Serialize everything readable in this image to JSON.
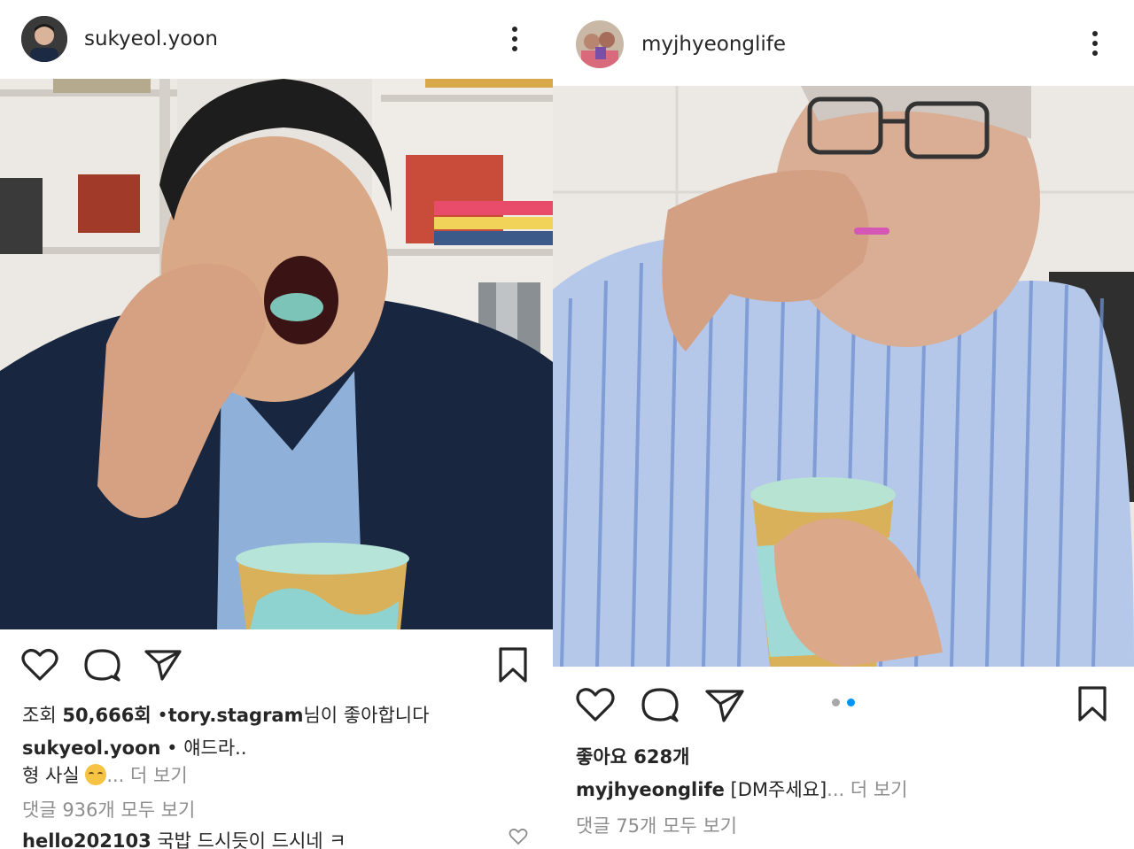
{
  "left_post": {
    "username": "sukyeol.yoon",
    "icons": {
      "more": "more-vertical-icon",
      "like": "heart-icon",
      "comment": "comment-icon",
      "share": "send-icon",
      "save": "bookmark-icon",
      "reel": "reels-badge-icon",
      "comment_like": "heart-small-icon"
    },
    "views_label": "조회",
    "views_count": "50,666회",
    "liked_by_sep": "•",
    "liked_by_user": "tory.stagram",
    "liked_by_suffix": "님이 좋아합니다",
    "caption_user": "sukyeol.yoon",
    "caption_text": " • 얘드라..",
    "caption_line2": "형 사실 ",
    "caption_more": "... 더 보기",
    "comments_link": "댓글 936개 모두 보기",
    "comment_user": "hello202103",
    "comment_text": " 국밥 드시듯이 드시네 ㅋ"
  },
  "right_post": {
    "username": "myjhyeonglife",
    "icons": {
      "more": "more-vertical-icon",
      "like": "heart-icon",
      "comment": "comment-icon",
      "share": "send-icon",
      "save": "bookmark-icon"
    },
    "carousel": {
      "count": 2,
      "active": 2,
      "active_color": "#0095f6",
      "inactive_color": "#a8a8a8"
    },
    "likes_label": "좋아요",
    "likes_count": "628개",
    "caption_user": "myjhyeonglife",
    "caption_text": " [DM주세요]",
    "caption_more": "... 더 보기",
    "comments_link": "댓글 75개 모두 보기"
  }
}
